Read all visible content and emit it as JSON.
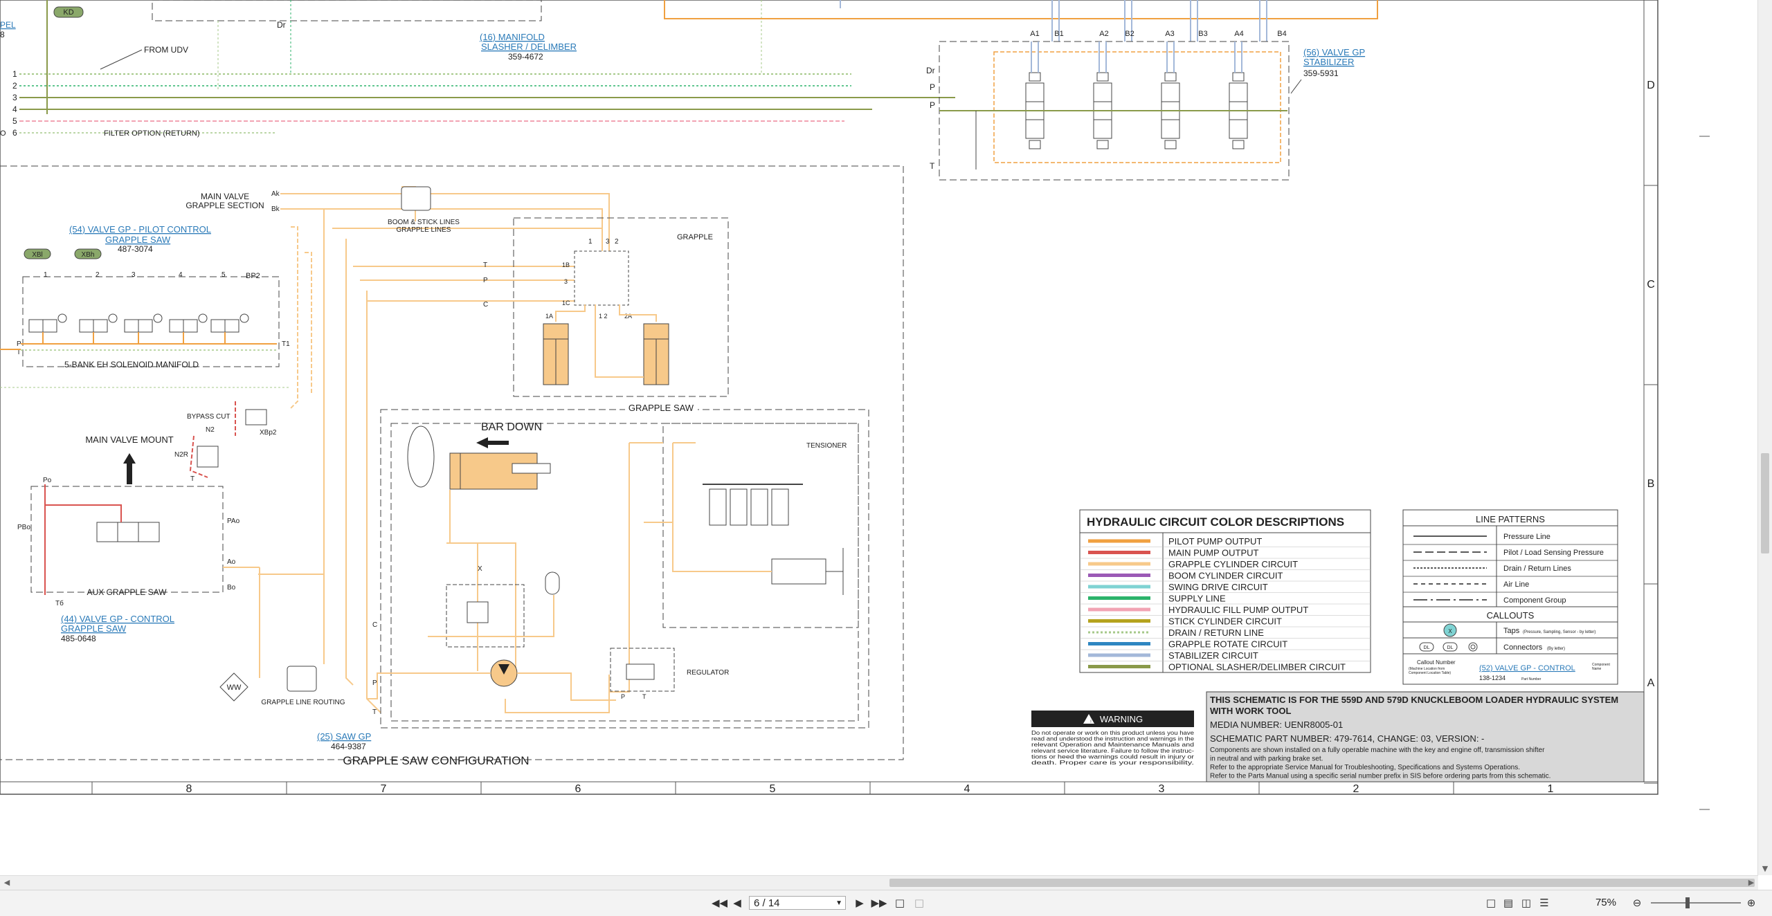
{
  "colors": {
    "pilot": "#f0a040",
    "main_pump": "#d9534f",
    "grapple_cyl": "#f7c98a",
    "boom_cyl": "#9b59b6",
    "swing": "#7fd3d3",
    "supply": "#2cb36b",
    "fill_pump": "#f2a3b3",
    "stick": "#b5a31e",
    "drain": "#a6c98a",
    "rotate": "#2e86c1",
    "stabilizer": "#a3b8d9",
    "optional": "#8a9a4a",
    "link": "#2a7ab8"
  },
  "top": {
    "kd": "KD",
    "pel": "PEL",
    "num8": "8",
    "dr": "Dr",
    "from_udv": "FROM UDV",
    "filter": "FILTER OPTION (RETURN)",
    "ports": [
      "1",
      "2",
      "3",
      "4",
      "5",
      "6"
    ],
    "port_o": "O",
    "manifold_link": [
      "(16) MANIFOLD",
      "SLASHER / DELIMBER"
    ],
    "manifold_part": "359-4672"
  },
  "stabilizer": {
    "ports": [
      "A1",
      "B1",
      "A2",
      "B2",
      "A3",
      "B3",
      "A4",
      "B4"
    ],
    "dr": "Dr",
    "p1": "P",
    "p2": "P",
    "t": "T",
    "link": [
      "(56) VALVE GP",
      "STABILIZER"
    ],
    "part": "359-5931"
  },
  "grapple_saw": {
    "main_valve": [
      "MAIN VALVE",
      "GRAPPLE SECTION"
    ],
    "ak": "Ak",
    "bk": "Bk",
    "boom_lines": [
      "BOOM & STICK LINES",
      "GRAPPLE LINES"
    ],
    "pilot_link": [
      "(54) VALVE GP - PILOT CONTROL",
      "GRAPPLE SAW"
    ],
    "pilot_part": "487-3074",
    "xbl": "XBl",
    "xbh": "XBh",
    "bank_nums": [
      "1",
      "2",
      "3",
      "4",
      "5"
    ],
    "bp2": "BP2",
    "p": "P",
    "t": "T",
    "t1": "T1",
    "manifold": "5-BANK EH SOLENOID MANIFOLD",
    "bypass": "BYPASS CUT",
    "n2": "N2",
    "n2r": "N2R",
    "xbp2": "XBp2",
    "tx": "T",
    "main_valve_mount": "MAIN VALVE MOUNT",
    "po": "Po",
    "pbo": "PBo",
    "pao": "PAo",
    "ao": "Ao",
    "bo": "Bo",
    "tb": "Tб",
    "aux": "AUX GRAPPLE SAW",
    "ctrl_link": [
      "(44) VALVE GP - CONTROL",
      "GRAPPLE SAW"
    ],
    "ctrl_part": "485-0648",
    "ww": "WW",
    "routing": "GRAPPLE LINE ROUTING",
    "grapple": "GRAPPLE",
    "g_ports": [
      "1",
      "3",
      "2"
    ],
    "t_lbl": "T",
    "p_lbl": "P",
    "c_lbl": "C",
    "g_1b": "1B",
    "g_3": "3",
    "g_1c": "1C",
    "g_1a": "1A",
    "g_12": "1 2",
    "g_2a": "2A",
    "saw_title": "GRAPPLE SAW",
    "bar_down": "BAR DOWN",
    "tensioner": "TENSIONER",
    "regulator": "REGULATOR",
    "saw_c": "C",
    "saw_p": "P",
    "saw_t": "T",
    "saw_x": "X",
    "saw_link": "(25) SAW GP",
    "saw_part": "464-9387",
    "config": "GRAPPLE SAW CONFIGURATION"
  },
  "legend": {
    "title": "HYDRAULIC CIRCUIT COLOR DESCRIPTIONS",
    "items": [
      {
        "label": "PILOT PUMP OUTPUT",
        "color": "#f0a040",
        "style": "solid"
      },
      {
        "label": "MAIN PUMP OUTPUT",
        "color": "#d9534f",
        "style": "solid"
      },
      {
        "label": "GRAPPLE CYLINDER CIRCUIT",
        "color": "#f7c98a",
        "style": "solid"
      },
      {
        "label": "BOOM CYLINDER CIRCUIT",
        "color": "#9b59b6",
        "style": "solid"
      },
      {
        "label": "SWING DRIVE CIRCUIT",
        "color": "#7fd3d3",
        "style": "solid"
      },
      {
        "label": "SUPPLY LINE",
        "color": "#2cb36b",
        "style": "solid"
      },
      {
        "label": "HYDRAULIC FILL PUMP OUTPUT",
        "color": "#f2a3b3",
        "style": "solid"
      },
      {
        "label": "STICK CYLINDER CIRCUIT",
        "color": "#b5a31e",
        "style": "solid"
      },
      {
        "label": "DRAIN / RETURN LINE",
        "color": "#a6c98a",
        "style": "dotted"
      },
      {
        "label": "GRAPPLE ROTATE CIRCUIT",
        "color": "#2e86c1",
        "style": "solid"
      },
      {
        "label": "STABILIZER CIRCUIT",
        "color": "#a3b8d9",
        "style": "solid"
      },
      {
        "label": "OPTIONAL SLASHER/DELIMBER CIRCUIT",
        "color": "#8a9a4a",
        "style": "solid"
      }
    ]
  },
  "patterns": {
    "title": "LINE PATTERNS",
    "items": [
      "Pressure Line",
      "Pilot / Load Sensing Pressure",
      "Drain / Return Lines",
      "Air Line",
      "Component Group"
    ],
    "callouts_title": "CALLOUTS",
    "taps": "Taps",
    "taps_small": "(Pressure, Sampling, Sensor - by letter)",
    "tap_letter": "X",
    "connectors": "Connectors",
    "connectors_small": "(By letter)",
    "dl": "DL",
    "callout_number": "Callout Number",
    "callout_small": [
      "(Machine Location from",
      "Component Location Table)"
    ],
    "component_name": [
      "Component",
      "Name"
    ],
    "example_link": "(52) VALVE GP - CONTROL",
    "example_part": "138-1234",
    "part_number": "Part Number"
  },
  "warning": {
    "title": "WARNING",
    "text": [
      "Do not operate or work on this product unless you have",
      "read and understood the instruction and warnings in the",
      "relevant Operation and Maintenance Manuals and",
      "relevant service literature. Failure to follow the instruc-",
      "tions or heed the warnings could result in injury or",
      "death. Proper care is your responsibility."
    ]
  },
  "titleblock": {
    "heading": [
      "THIS SCHEMATIC IS FOR THE 559D AND 579D KNUCKLEBOOM LOADER HYDRAULIC SYSTEM",
      "WITH WORK TOOL"
    ],
    "media": "MEDIA NUMBER: UENR8005-01",
    "schematic": "SCHEMATIC PART NUMBER: 479-7614, CHANGE: 03, VERSION: -",
    "notes": [
      "Components are shown installed on a fully operable machine with the key and engine off, transmission shifter",
      "in neutral and with parking brake set.",
      "Refer to the appropriate Service Manual for Troubleshooting, Specifications and Systems Operations.",
      "Refer to the Parts Manual using a specific serial number prefix in SIS before ordering parts from this schematic."
    ]
  },
  "border": {
    "cols": [
      "8",
      "7",
      "6",
      "5",
      "4",
      "3",
      "2",
      "1"
    ],
    "rows": [
      "D",
      "C",
      "B",
      "A"
    ]
  },
  "toolbar": {
    "page": "6 / 14",
    "zoom": "75%"
  }
}
